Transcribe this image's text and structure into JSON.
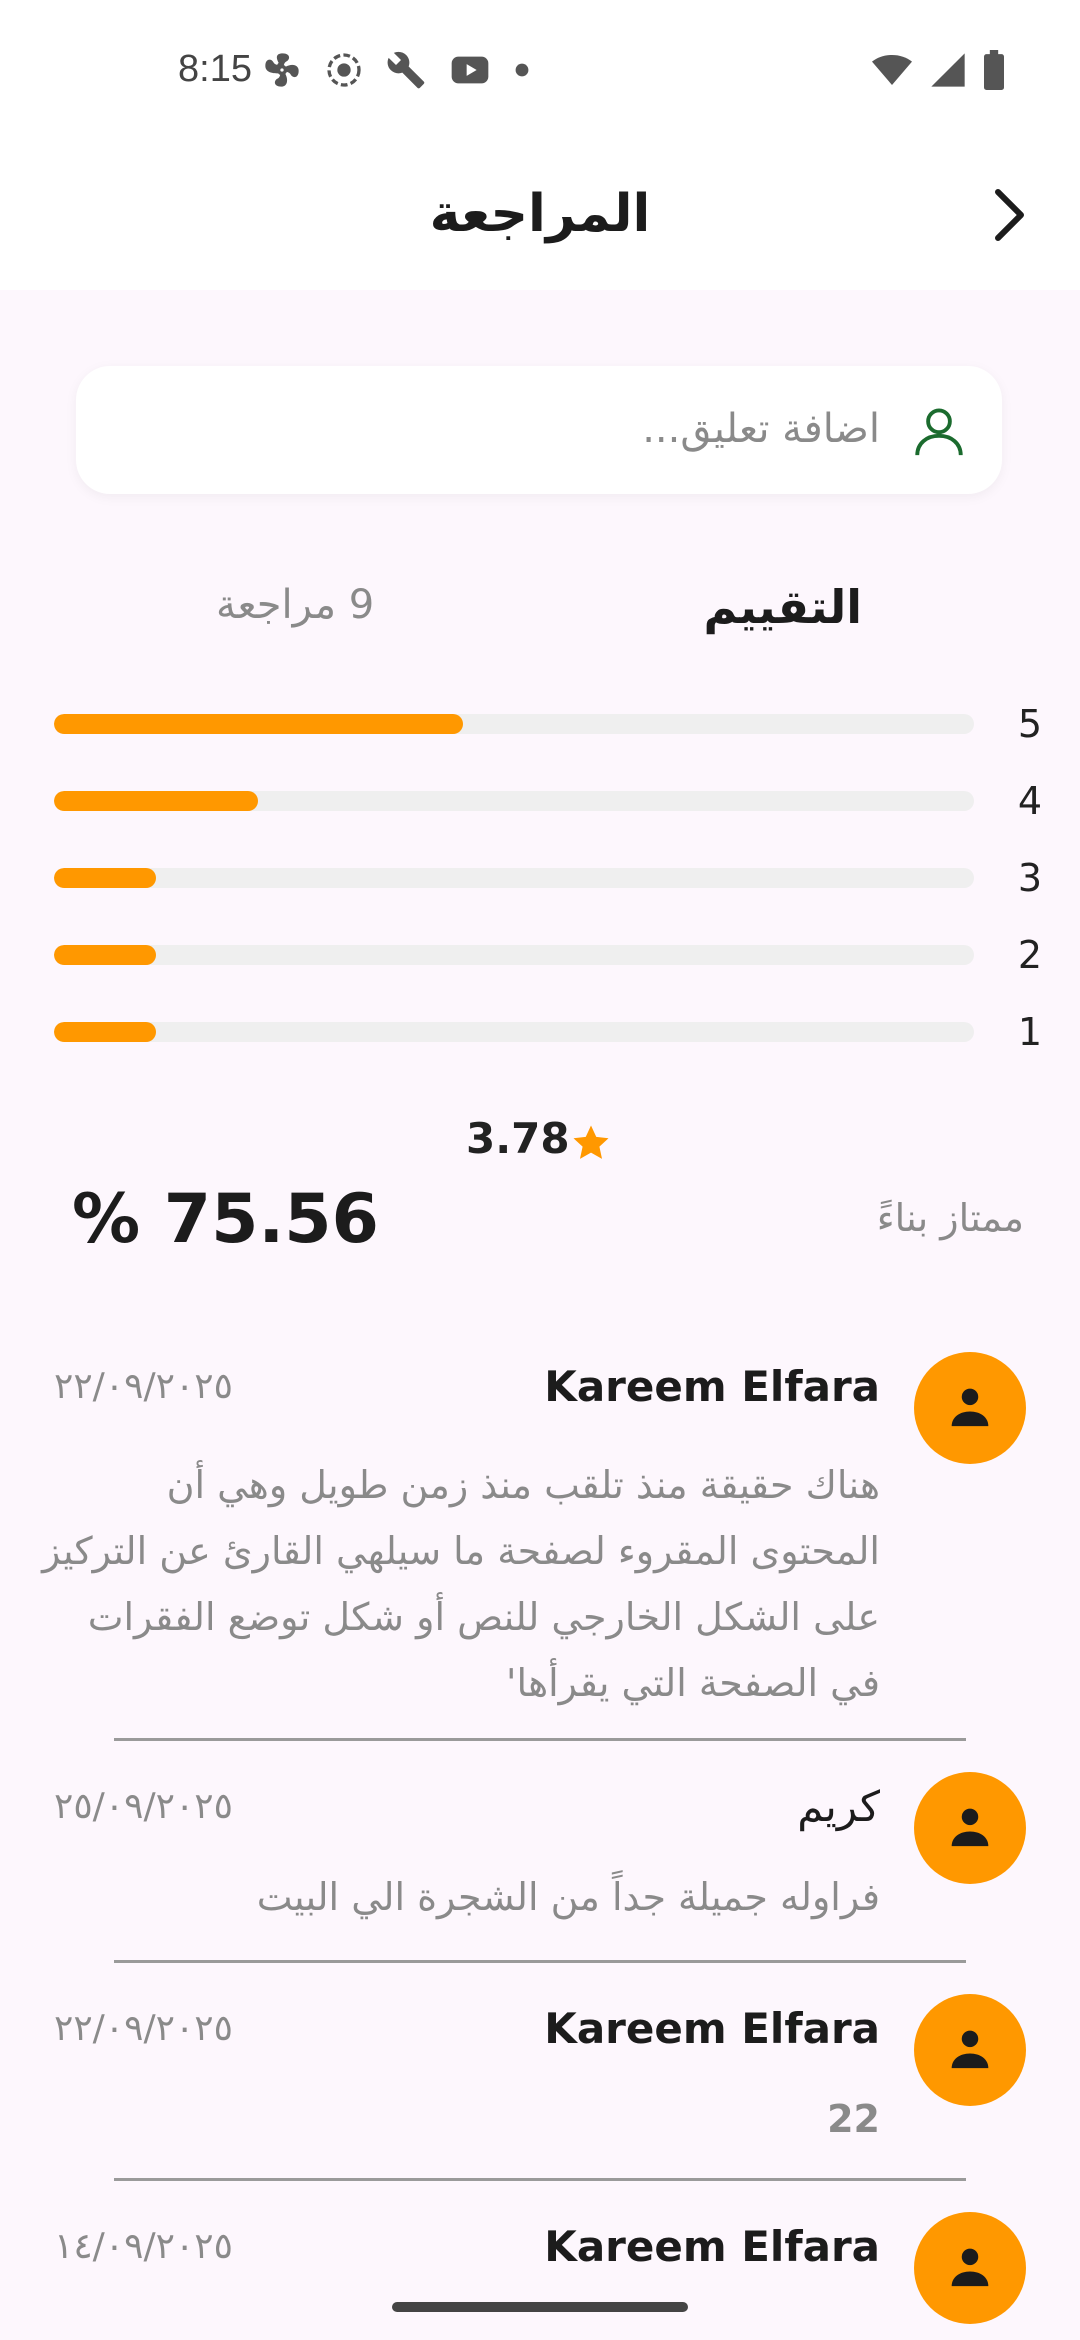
{
  "status_bar": {
    "time": "8:15"
  },
  "header": {
    "title": "المراجعة"
  },
  "comment": {
    "placeholder": "اضافة تعليق..."
  },
  "tabs": {
    "rating": "التقييم",
    "reviews_count": "9 مراجعة"
  },
  "rating_bars": [
    {
      "label": "5",
      "fraction": 0.445
    },
    {
      "label": "4",
      "fraction": 0.222
    },
    {
      "label": "3",
      "fraction": 0.111
    },
    {
      "label": "2",
      "fraction": 0.111
    },
    {
      "label": "1",
      "fraction": 0.111
    }
  ],
  "summary": {
    "average": "3.78",
    "percent": "% 75.56",
    "quality": "ممتاز بناءً"
  },
  "reviews": [
    {
      "name": "Kareem Elfara",
      "date": "٢٢/٠٩/٢٠٢٥",
      "text": "هناك حقيقة منذ تلقب منذ زمن طويل وهي أن المحتوى المقروء لصفحة ما سيلهي القارئ عن التركيز على الشكل الخارجي للنص أو شكل توضع الفقرات في الصفحة التي يقرأها'"
    },
    {
      "name": "كريم",
      "date": "٢٥/٠٩/٢٠٢٥",
      "text": "فراوله جميلة جداً من الشجرة الي البيت"
    },
    {
      "name": "Kareem Elfara",
      "date": "٢٢/٠٩/٢٠٢٥",
      "text": "22"
    },
    {
      "name": "Kareem Elfara",
      "date": "١٤/٠٩/٢٠٢٥",
      "text": "...."
    }
  ],
  "colors": {
    "accent": "#ff9800",
    "track": "#efefef",
    "background": "#fdf7fd",
    "icon_green": "#1b6b2e"
  }
}
